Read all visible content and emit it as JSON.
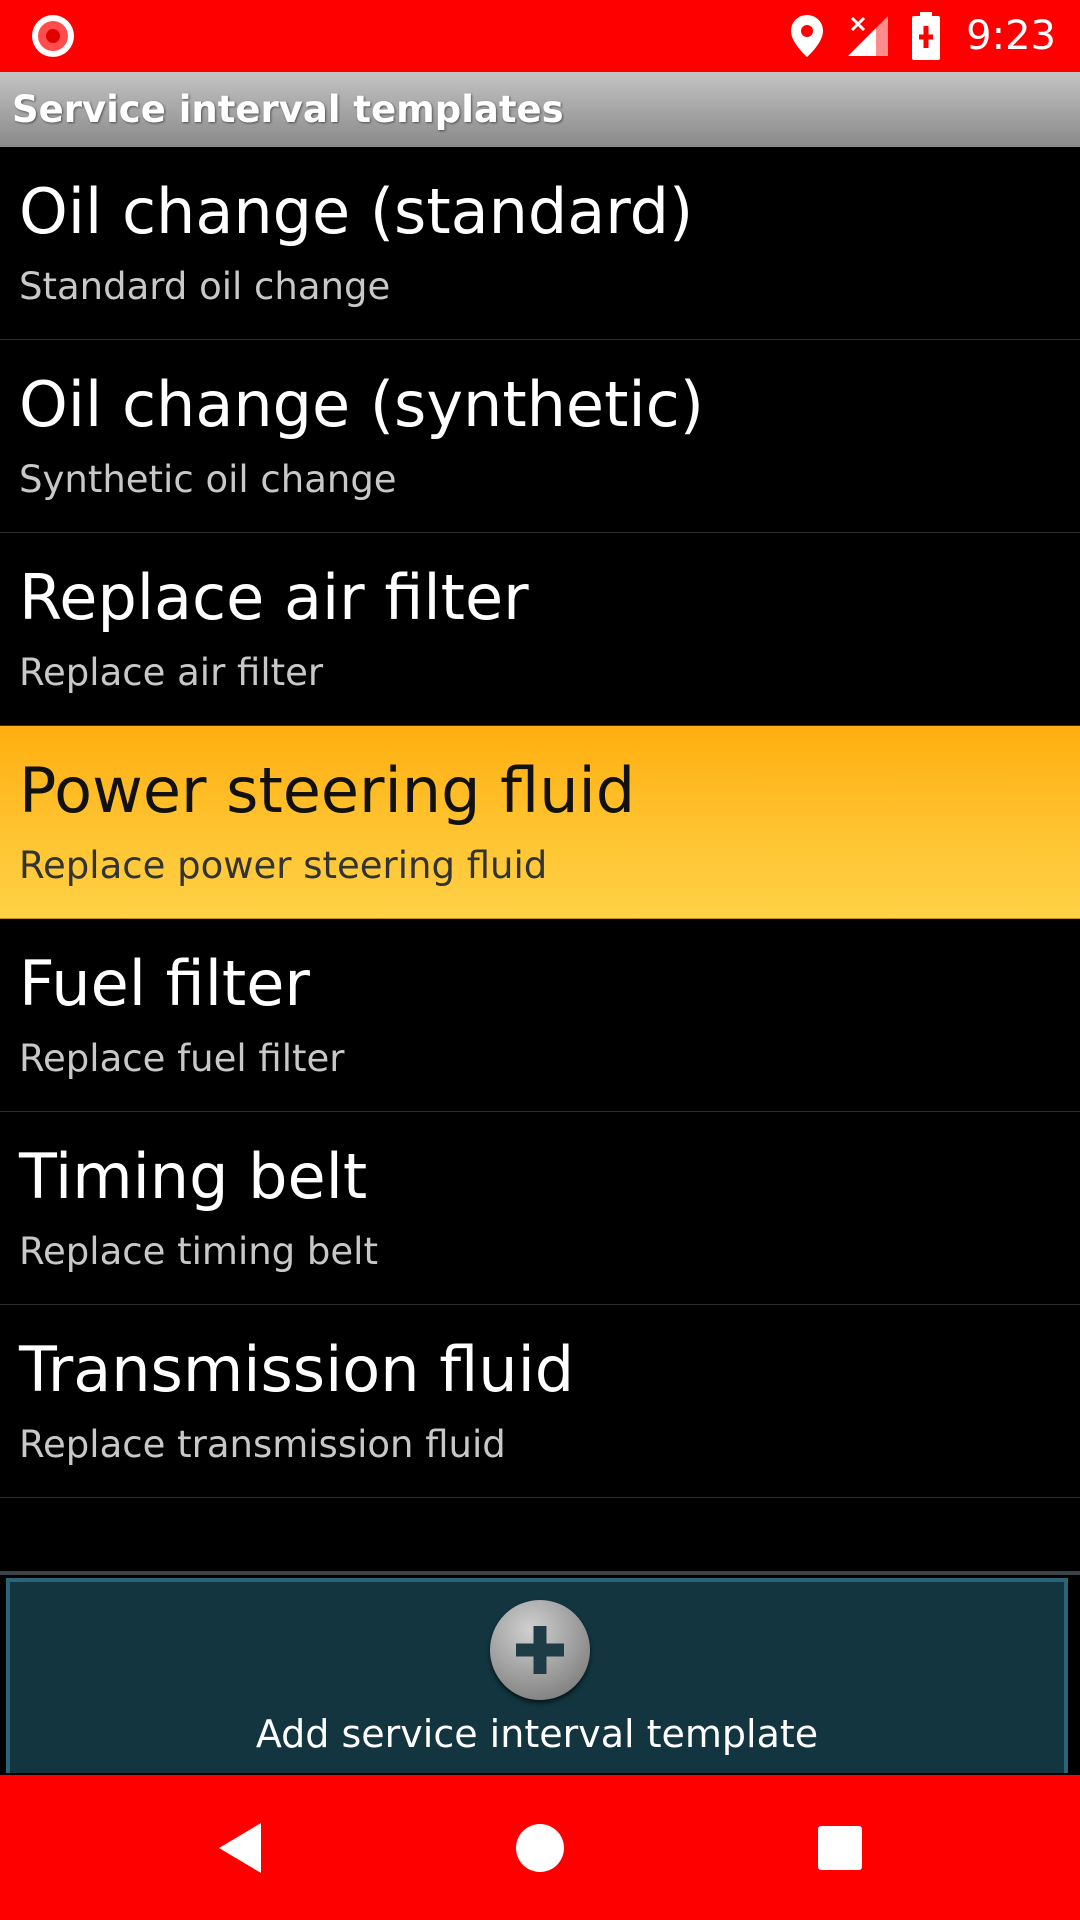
{
  "status_bar": {
    "time": "9:23",
    "icons": [
      "record-icon",
      "location-icon",
      "signal-no-data-icon",
      "battery-charging-icon"
    ]
  },
  "header": {
    "title": "Service interval templates"
  },
  "list": {
    "items": [
      {
        "title": "Oil change (standard)",
        "subtitle": "Standard oil change",
        "highlighted": false
      },
      {
        "title": "Oil change (synthetic)",
        "subtitle": "Synthetic oil change",
        "highlighted": false
      },
      {
        "title": "Replace air filter",
        "subtitle": "Replace air filter",
        "highlighted": false
      },
      {
        "title": "Power steering fluid",
        "subtitle": "Replace power steering fluid",
        "highlighted": true
      },
      {
        "title": "Fuel filter",
        "subtitle": "Replace fuel filter",
        "highlighted": false
      },
      {
        "title": "Timing belt",
        "subtitle": "Replace timing belt",
        "highlighted": false
      },
      {
        "title": "Transmission fluid",
        "subtitle": "Replace transmission fluid",
        "highlighted": false
      }
    ]
  },
  "add_button": {
    "label": "Add service interval template",
    "icon": "plus-icon"
  },
  "nav_bar": {
    "buttons": [
      "back-icon",
      "home-icon",
      "recents-icon"
    ]
  },
  "colors": {
    "status_bar": "#ff0000",
    "highlight": "#ffc22e",
    "add_panel": "#12353f"
  }
}
